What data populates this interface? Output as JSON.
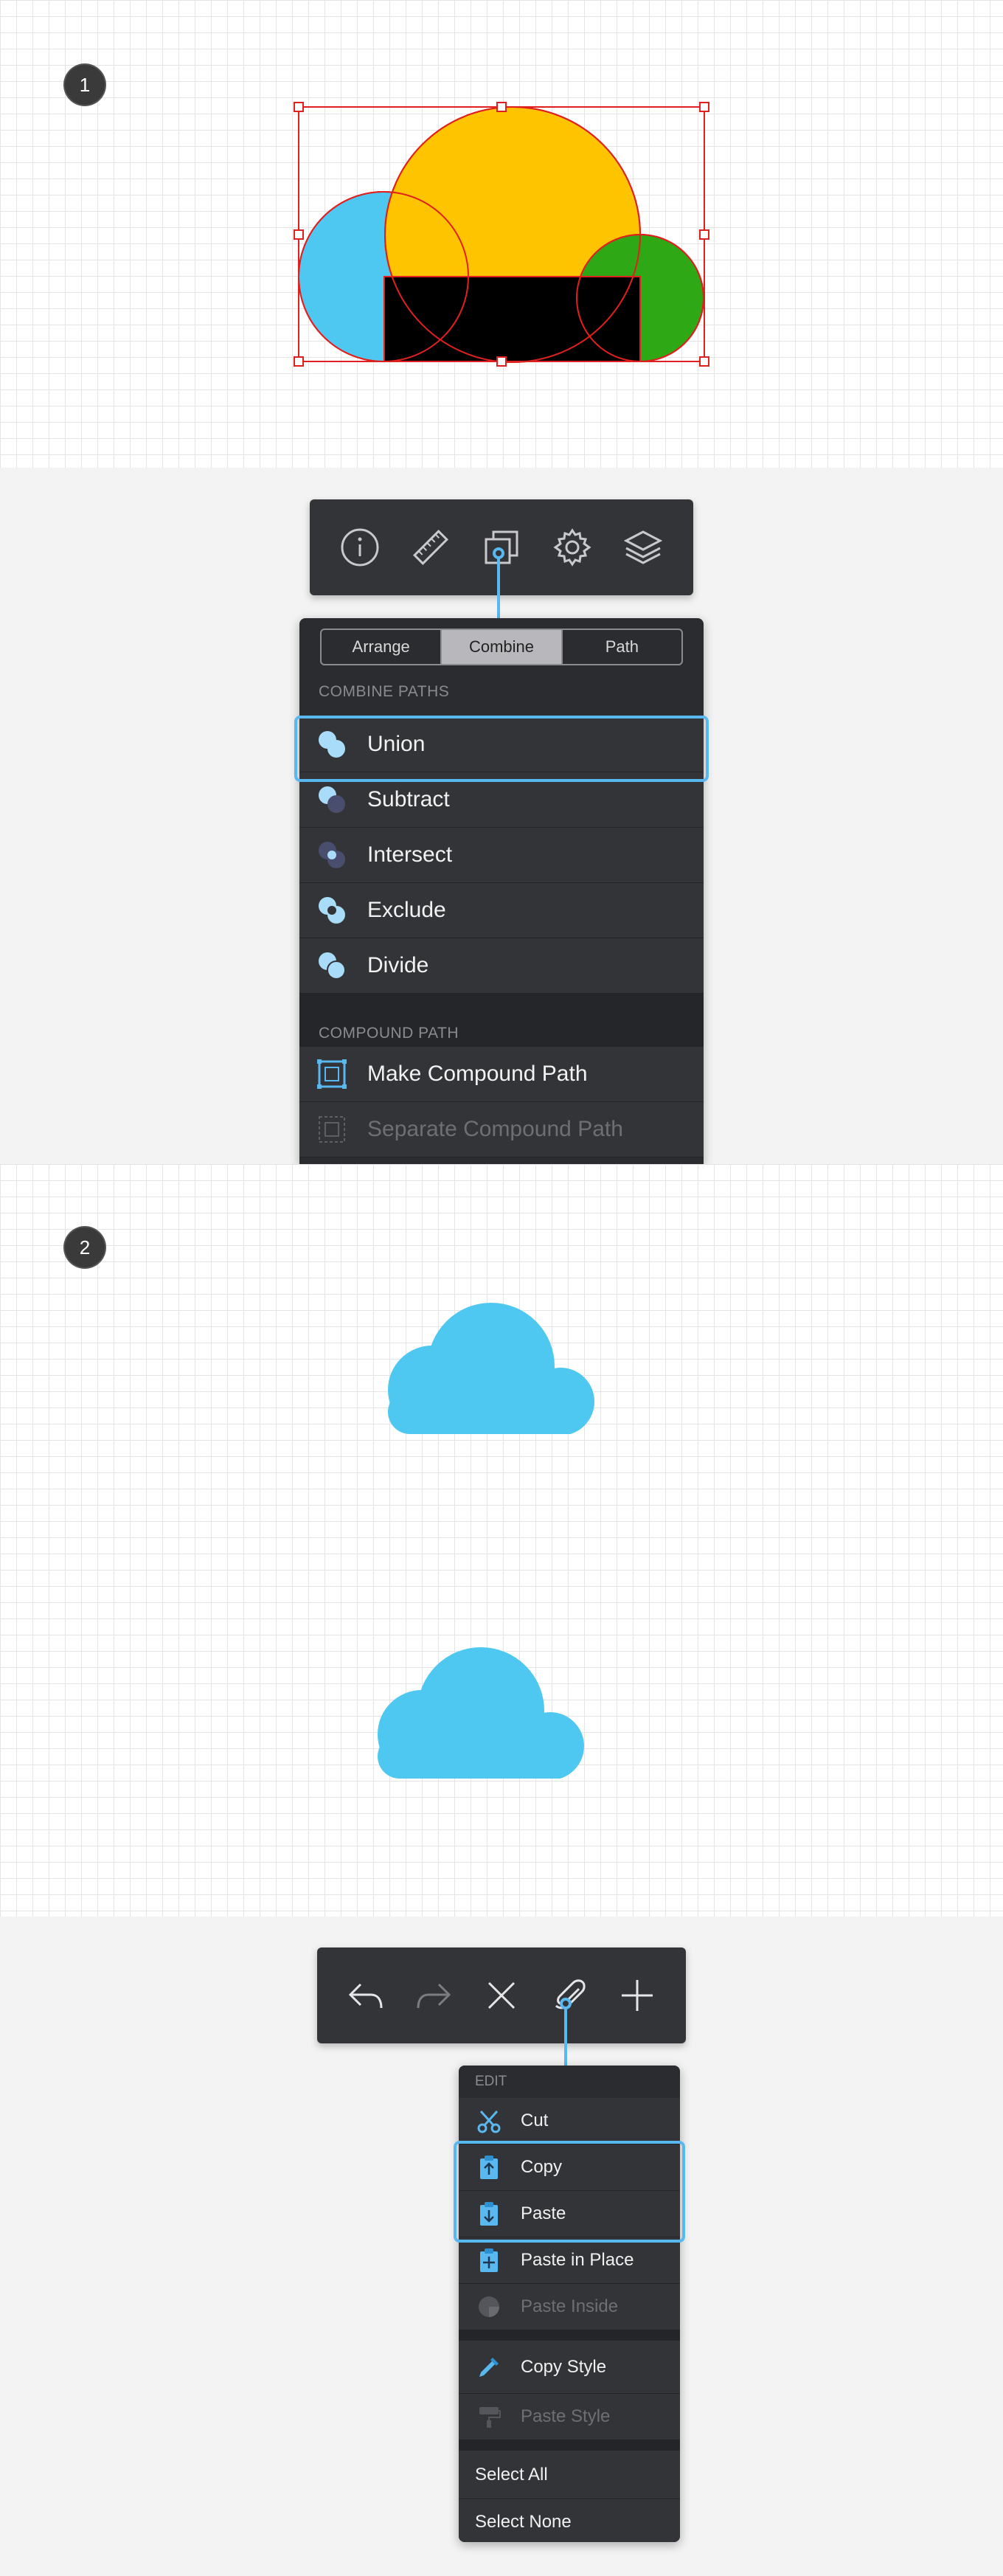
{
  "step1": {
    "badge": "1"
  },
  "step2": {
    "badge": "2"
  },
  "shapes": {
    "colors": {
      "blue": "#4ec8f0",
      "yellow": "#ffc400",
      "green": "#2ea815",
      "black": "#000000",
      "selection": "#e0201e"
    }
  },
  "inspector_toolbar": {
    "icons": [
      "info-icon",
      "ruler-icon",
      "path-panel-icon",
      "gear-icon",
      "layers-icon"
    ]
  },
  "path_panel": {
    "tabs": [
      "Arrange",
      "Combine",
      "Path"
    ],
    "active_tab": "Combine",
    "combine_header": "COMBINE PATHS",
    "combine_items": [
      {
        "label": "Union",
        "icon": "union-icon"
      },
      {
        "label": "Subtract",
        "icon": "subtract-icon"
      },
      {
        "label": "Intersect",
        "icon": "intersect-icon"
      },
      {
        "label": "Exclude",
        "icon": "exclude-icon"
      },
      {
        "label": "Divide",
        "icon": "divide-icon"
      }
    ],
    "highlighted": "Union",
    "compound_header": "COMPOUND PATH",
    "compound_items": [
      {
        "label": "Make Compound Path",
        "icon": "make-compound-icon",
        "enabled": true
      },
      {
        "label": "Separate Compound Path",
        "icon": "separate-compound-icon",
        "enabled": false
      }
    ]
  },
  "cloud_color": "#4ec8f0",
  "edit_toolbar": {
    "icons": [
      "undo-icon",
      "redo-icon",
      "delete-icon",
      "paperclip-icon",
      "add-icon"
    ]
  },
  "edit_menu": {
    "header": "EDIT",
    "group1": [
      {
        "label": "Cut",
        "icon": "scissors-icon",
        "enabled": true
      },
      {
        "label": "Copy",
        "icon": "copy-icon",
        "enabled": true
      },
      {
        "label": "Paste",
        "icon": "paste-icon",
        "enabled": true
      },
      {
        "label": "Paste in Place",
        "icon": "paste-in-place-icon",
        "enabled": true
      },
      {
        "label": "Paste Inside",
        "icon": "paste-inside-icon",
        "enabled": false
      }
    ],
    "group2": [
      {
        "label": "Copy Style",
        "icon": "eyedropper-icon",
        "enabled": true
      },
      {
        "label": "Paste Style",
        "icon": "paint-roller-icon",
        "enabled": false
      }
    ],
    "group3": [
      {
        "label": "Select All"
      },
      {
        "label": "Select None"
      }
    ],
    "highlighted": [
      "Copy",
      "Paste"
    ]
  }
}
